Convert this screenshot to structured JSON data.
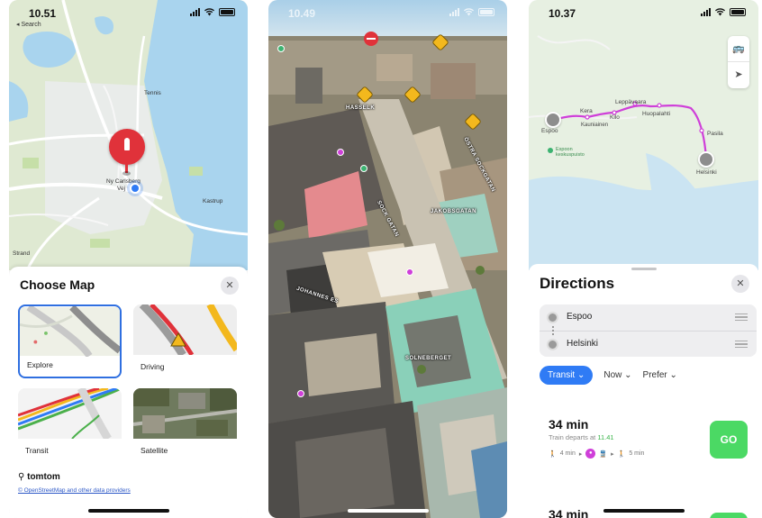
{
  "screen1": {
    "status_time": "10.51",
    "back_label": "◂ Search",
    "map_labels": [
      "Tennis",
      "Kastrup",
      "Strand"
    ],
    "pin_label_line1": "Ny Carlsberg",
    "pin_label_line2": "Vej",
    "sheet_title": "Choose Map",
    "close_glyph": "✕",
    "map_types": [
      {
        "label": "Explore"
      },
      {
        "label": "Driving"
      },
      {
        "label": "Transit"
      },
      {
        "label": "Satellite"
      }
    ],
    "provider": "tomtom",
    "attribution": "© OpenStreetMap and other data providers"
  },
  "screen2": {
    "status_time": "10.49",
    "street_labels": [
      "HASSELK",
      "JAKOBSGATAN",
      "SOCK GATAN",
      "ÖSTRA SOCKGATAN",
      "SOLNEBERGET",
      "JOHANNES ES"
    ]
  },
  "screen3": {
    "status_time": "10.37",
    "map_labels": {
      "espoo": "Espoo",
      "helsinki": "Helsinki",
      "kera": "Kera",
      "kauniainen": "Kauniainen",
      "kilo": "Kilo",
      "leppavaara": "Leppävaara",
      "huopalahti": "Huopalahti",
      "pasila": "Pasila",
      "espoon_keskuspuisto": "Espoon keskuspuisto"
    },
    "sheet_title": "Directions",
    "close_glyph": "✕",
    "origin": "Espoo",
    "destination": "Helsinki",
    "filters": {
      "transit": "Transit ⌄",
      "now": "Now ⌄",
      "prefer": "Prefer ⌄"
    },
    "routes": [
      {
        "duration": "34 min",
        "departs": "Train departs at",
        "departs_time": "11.41",
        "walk_start": "4 min",
        "walk_end": "5 min",
        "go_label": "GO"
      },
      {
        "duration": "34 min"
      }
    ]
  },
  "colors": {
    "accent_blue": "#2f7bf5",
    "go_green": "#4bd964",
    "pin_red": "#e0323a",
    "transit_purple": "#cf3fd9"
  }
}
